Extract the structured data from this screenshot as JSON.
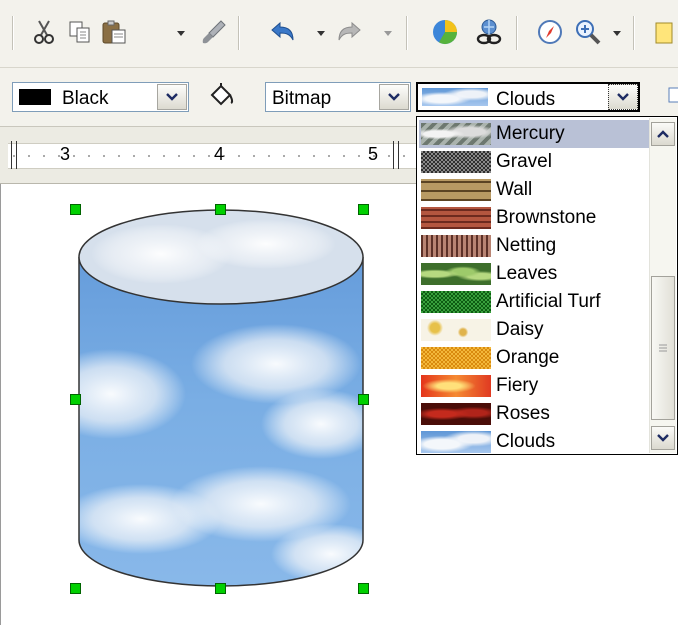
{
  "toolbar": {
    "icons": [
      "cut-icon",
      "copy-icon",
      "paste-icon",
      "format-paintbrush-icon",
      "undo-icon",
      "redo-icon",
      "chart-icon",
      "hyperlink-icon",
      "navigator-icon",
      "zoom-icon"
    ]
  },
  "area_toolbar": {
    "line_color": {
      "swatch": "#000000",
      "label": "Black"
    },
    "fill_style": {
      "label": "Bitmap"
    },
    "fill_bitmap": {
      "label": "Clouds"
    }
  },
  "ruler": {
    "marks": [
      "3",
      "4",
      "5"
    ]
  },
  "bitmap_dropdown": {
    "selected": "Mercury",
    "items": [
      {
        "label": "Mercury",
        "pattern": "mercury"
      },
      {
        "label": "Gravel",
        "pattern": "gravel"
      },
      {
        "label": "Wall",
        "pattern": "wall"
      },
      {
        "label": "Brownstone",
        "pattern": "brownstone"
      },
      {
        "label": "Netting",
        "pattern": "netting"
      },
      {
        "label": "Leaves",
        "pattern": "leaves"
      },
      {
        "label": "Artificial Turf",
        "pattern": "turf"
      },
      {
        "label": "Daisy",
        "pattern": "daisy"
      },
      {
        "label": "Orange",
        "pattern": "orange"
      },
      {
        "label": "Fiery",
        "pattern": "fiery"
      },
      {
        "label": "Roses",
        "pattern": "roses"
      },
      {
        "label": "Clouds",
        "pattern": "clouds"
      }
    ]
  },
  "colors": {
    "toolbar_bg": "#f3f2ec",
    "selection_bg": "#b9c1d6",
    "handle": "#00d000",
    "sky": "#6fa3de"
  }
}
